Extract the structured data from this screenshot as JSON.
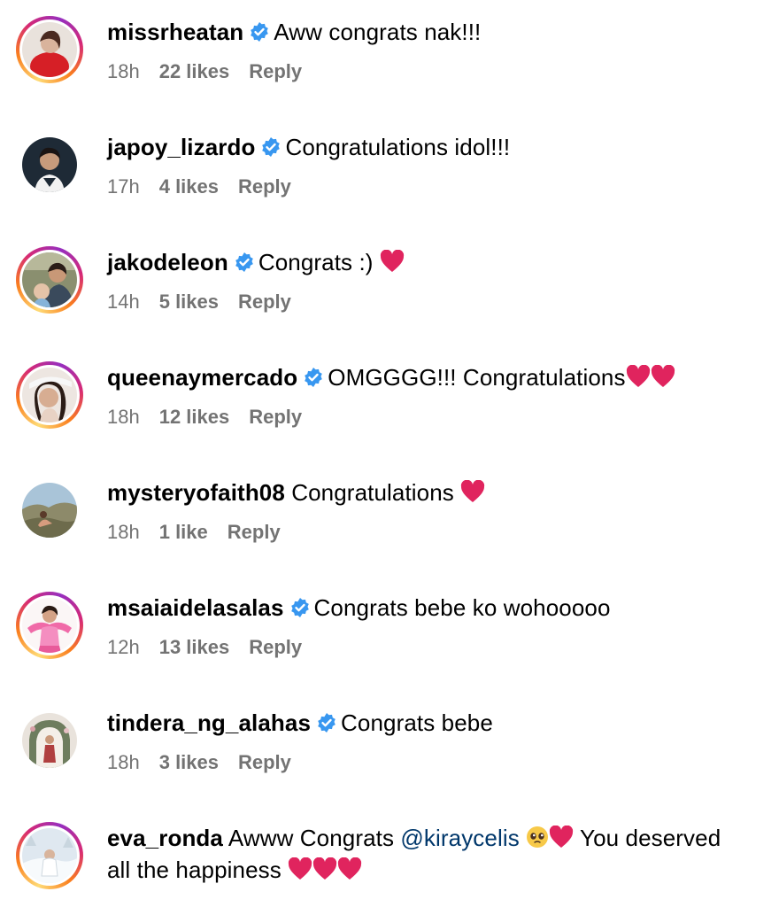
{
  "comments": [
    {
      "username": "missrheatan",
      "verified": true,
      "story": true,
      "text": "Aww congrats nak!!!",
      "time": "18h",
      "likes": "22 likes",
      "reply": "Reply"
    },
    {
      "username": "japoy_lizardo",
      "verified": true,
      "story": false,
      "text": "Congratulations idol!!!",
      "time": "17h",
      "likes": "4 likes",
      "reply": "Reply"
    },
    {
      "username": "jakodeleon",
      "verified": true,
      "story": true,
      "text": "Congrats :)",
      "time": "14h",
      "likes": "5 likes",
      "reply": "Reply"
    },
    {
      "username": "queenaymercado",
      "verified": true,
      "story": true,
      "text": "OMGGGG!!! Congratulations",
      "time": "18h",
      "likes": "12 likes",
      "reply": "Reply"
    },
    {
      "username": "mysteryofaith08",
      "verified": false,
      "story": false,
      "text": "Congratulations",
      "time": "18h",
      "likes": "1 like",
      "reply": "Reply"
    },
    {
      "username": "msaiaidelasalas",
      "verified": true,
      "story": true,
      "text": "Congrats bebe ko wohooooo",
      "time": "12h",
      "likes": "13 likes",
      "reply": "Reply"
    },
    {
      "username": "tindera_ng_alahas",
      "verified": true,
      "story": false,
      "text": "Congrats bebe",
      "time": "18h",
      "likes": "3 likes",
      "reply": "Reply"
    },
    {
      "username": "eva_ronda",
      "verified": false,
      "story": true,
      "text_before": "Awww Congrats",
      "mention": "@kiraycelis",
      "text_after": "You deserved",
      "text_line2": "all the happiness"
    }
  ],
  "colors": {
    "verified_badge": "#3897f0",
    "heart": "#e0245e",
    "meta_text": "#737373",
    "mention": "#00376b"
  },
  "icons": {
    "verified": "verified-badge-icon",
    "heart": "red-heart-emoji",
    "pleading": "pleading-face-emoji"
  }
}
